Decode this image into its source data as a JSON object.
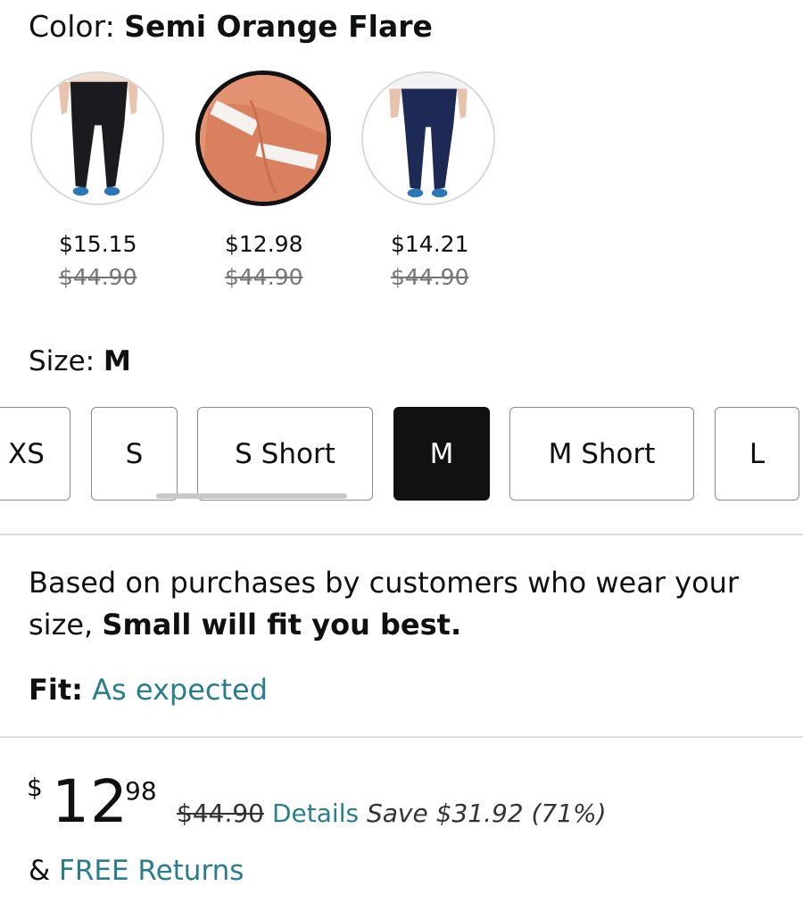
{
  "color": {
    "label": "Color: ",
    "value": "Semi Orange Flare"
  },
  "swatches": [
    {
      "name": "black",
      "price": "$15.15",
      "list_price": "$44.90",
      "selected": false
    },
    {
      "name": "semi-orange-flare",
      "price": "$12.98",
      "list_price": "$44.90",
      "selected": true
    },
    {
      "name": "navy",
      "price": "$14.21",
      "list_price": "$44.90",
      "selected": false
    }
  ],
  "size": {
    "label": "Size: ",
    "value": "M",
    "options": [
      "XS",
      "S",
      "S Short",
      "M",
      "M Short",
      "L"
    ]
  },
  "fit": {
    "recommendation_prefix": "Based on purchases by customers who wear your size, ",
    "recommendation_bold": "Small will fit you best.",
    "fit_label": "Fit:",
    "fit_value": "As expected"
  },
  "pricing": {
    "currency": "$",
    "whole": "12",
    "fraction": "98",
    "list_price": "$44.90",
    "details_link": "Details",
    "savings": "Save $31.92 (71%)",
    "returns_prefix": "& ",
    "returns_link": "FREE Returns"
  },
  "colors": {
    "link": "#2a7e8c",
    "selected_size_bg": "#111111",
    "swatch_orange": "#e0896b"
  }
}
